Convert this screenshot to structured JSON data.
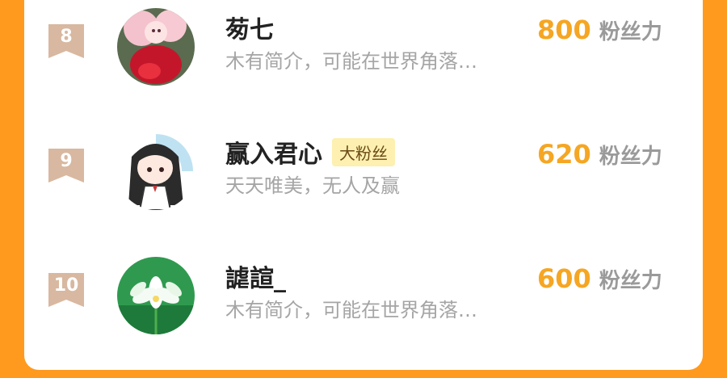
{
  "colors": {
    "background": "#ff9a1f",
    "card": "#ffffff",
    "badge": "#d8b8a0",
    "score": "#f5a623",
    "tag_bg": "#fdf0b0"
  },
  "rows": [
    {
      "rank": "8",
      "name": "茐七",
      "tag": "",
      "bio": "木有简介，可能在世界角落…",
      "score": "800",
      "unit": "粉丝力",
      "avatar_icon": "avatar-red-dress-girl"
    },
    {
      "rank": "9",
      "name": "赢入君心",
      "tag": "大粉丝",
      "bio": "天天唯美，无人及赢",
      "score": "620",
      "unit": "粉丝力",
      "avatar_icon": "avatar-chibi-girl"
    },
    {
      "rank": "10",
      "name": "謔諠_",
      "tag": "",
      "bio": "木有简介，可能在世界角落…",
      "score": "600",
      "unit": "粉丝力",
      "avatar_icon": "avatar-white-lotus"
    }
  ]
}
